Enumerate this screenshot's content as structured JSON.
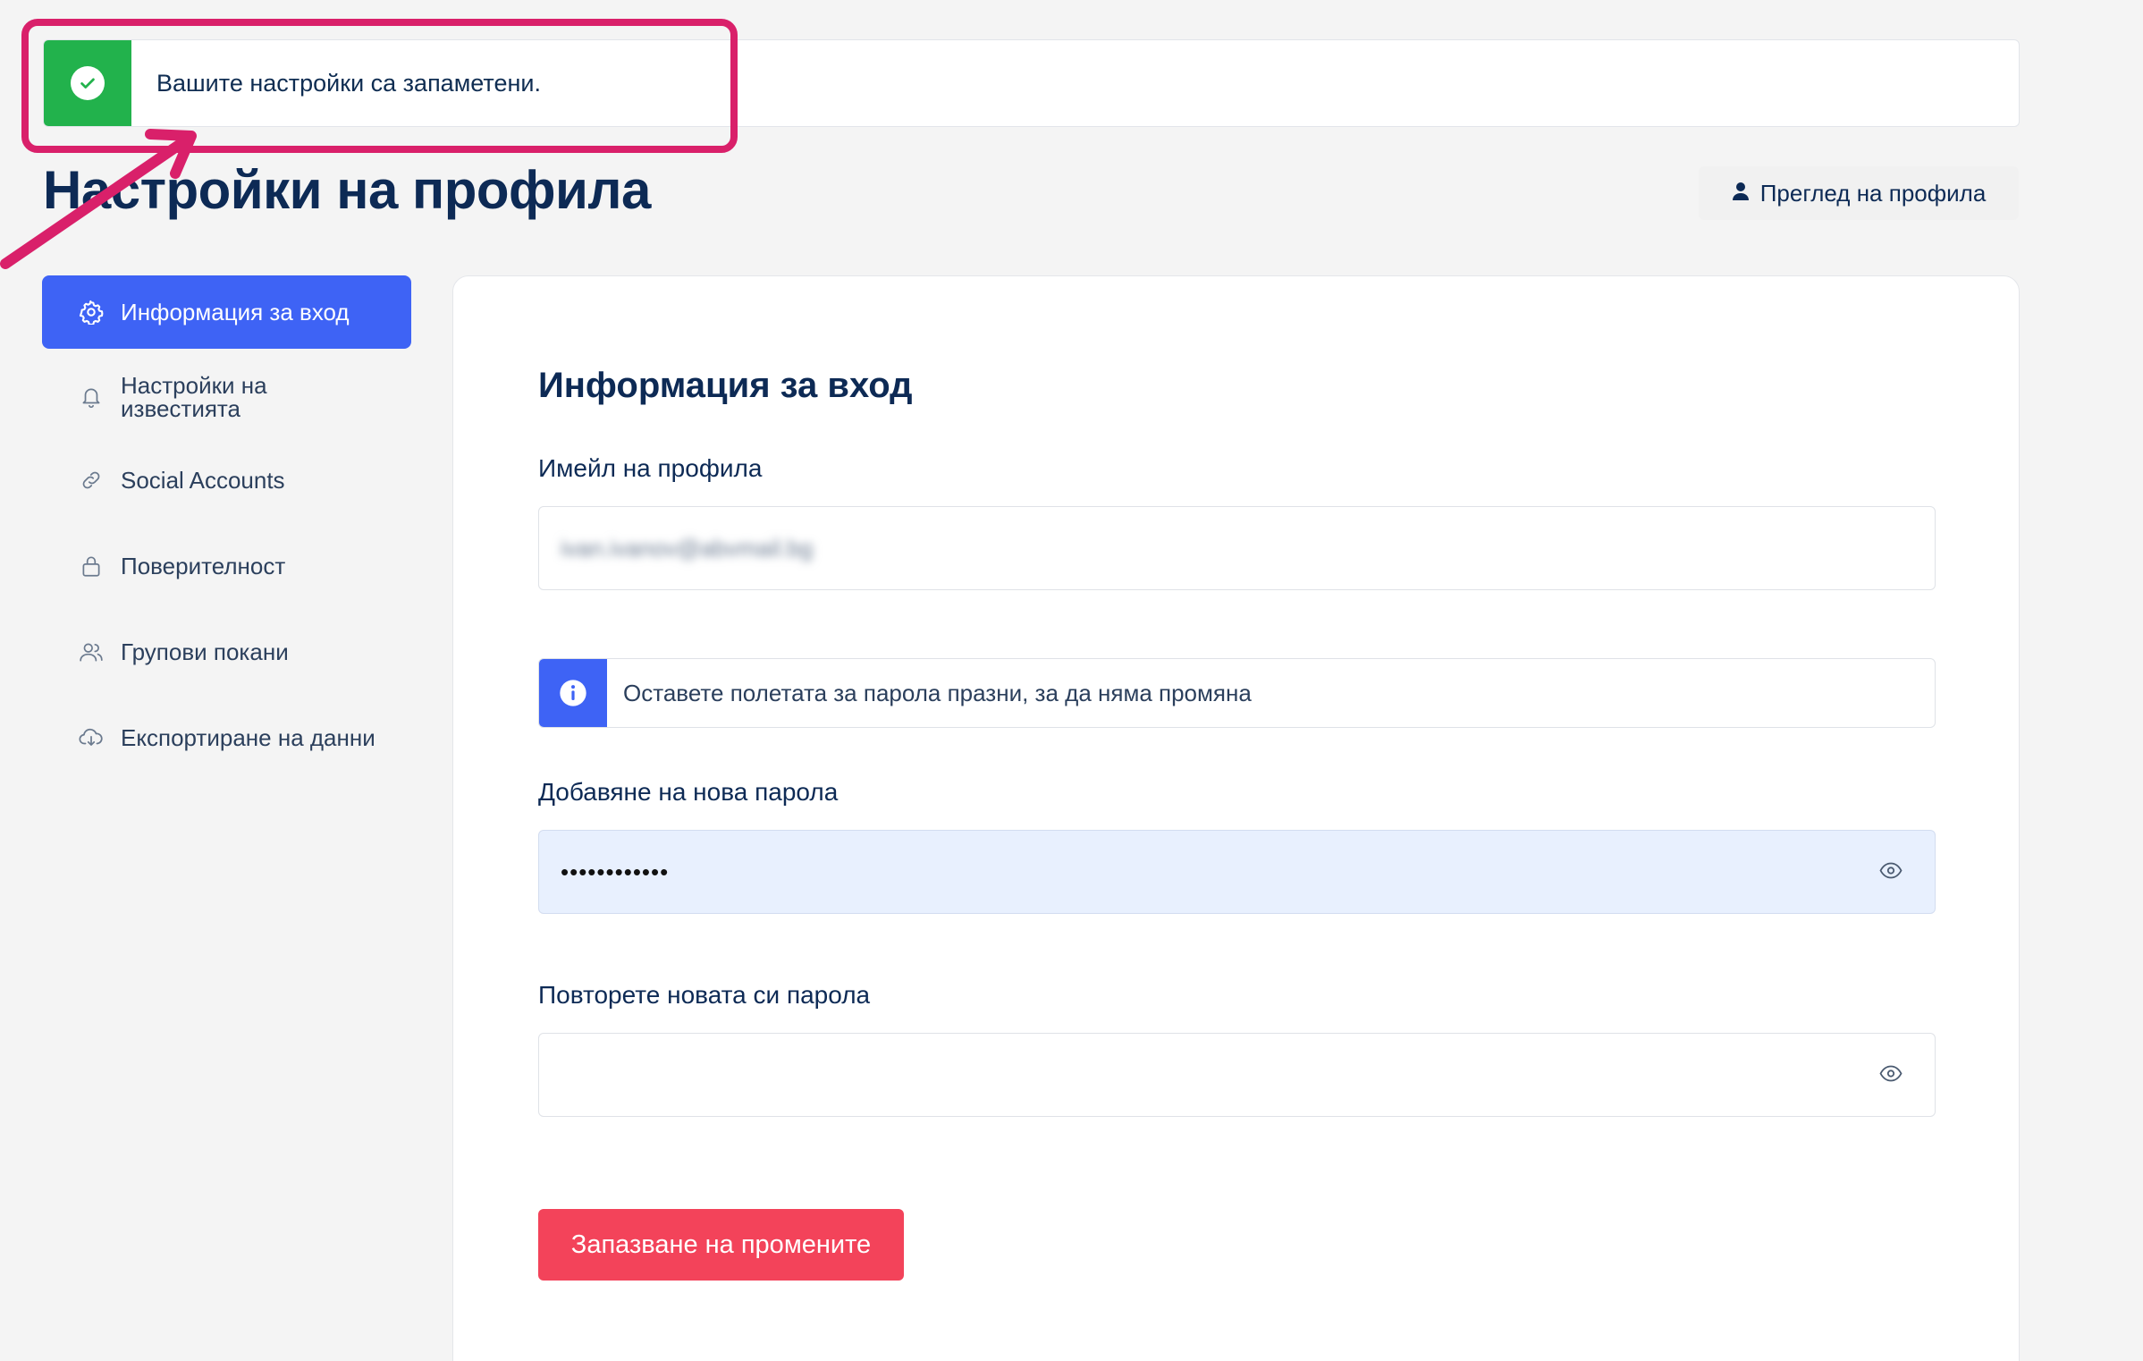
{
  "notice": {
    "text": "Вашите настройки са запаметени.",
    "color": "#22b24c",
    "icon": "check-icon"
  },
  "header": {
    "title": "Настройки на профила",
    "view_profile_label": "Преглед на профила",
    "view_profile_icon": "user-icon"
  },
  "sidebar": {
    "items": [
      {
        "label": "Информация за вход",
        "icon": "gear-icon",
        "active": true
      },
      {
        "label": "Настройки на известията",
        "icon": "bell-icon",
        "active": false
      },
      {
        "label": "Social Accounts",
        "icon": "link-icon",
        "active": false
      },
      {
        "label": "Поверителност",
        "icon": "lock-icon",
        "active": false
      },
      {
        "label": "Групови покани",
        "icon": "users-icon",
        "active": false
      },
      {
        "label": "Експортиране на данни",
        "icon": "cloud-download-icon",
        "active": false
      }
    ]
  },
  "main": {
    "section_title": "Информация за вход",
    "email": {
      "label": "Имейл на профила",
      "value": "ivan.ivanov@abvmail.bg"
    },
    "info": {
      "text": "Оставете полетата за парола празни, за да няма промяна"
    },
    "new_password": {
      "label": "Добавяне на нова парола",
      "value": "••••••••••••"
    },
    "repeat_password": {
      "label": "Повторете новата си парола",
      "value": ""
    },
    "save_label": "Запазване на промените"
  },
  "colors": {
    "accent": "#3e63f5",
    "primary_button": "#f3435a",
    "success": "#22b24c",
    "annotation": "#d9206a",
    "text_dark": "#0d2a55"
  }
}
